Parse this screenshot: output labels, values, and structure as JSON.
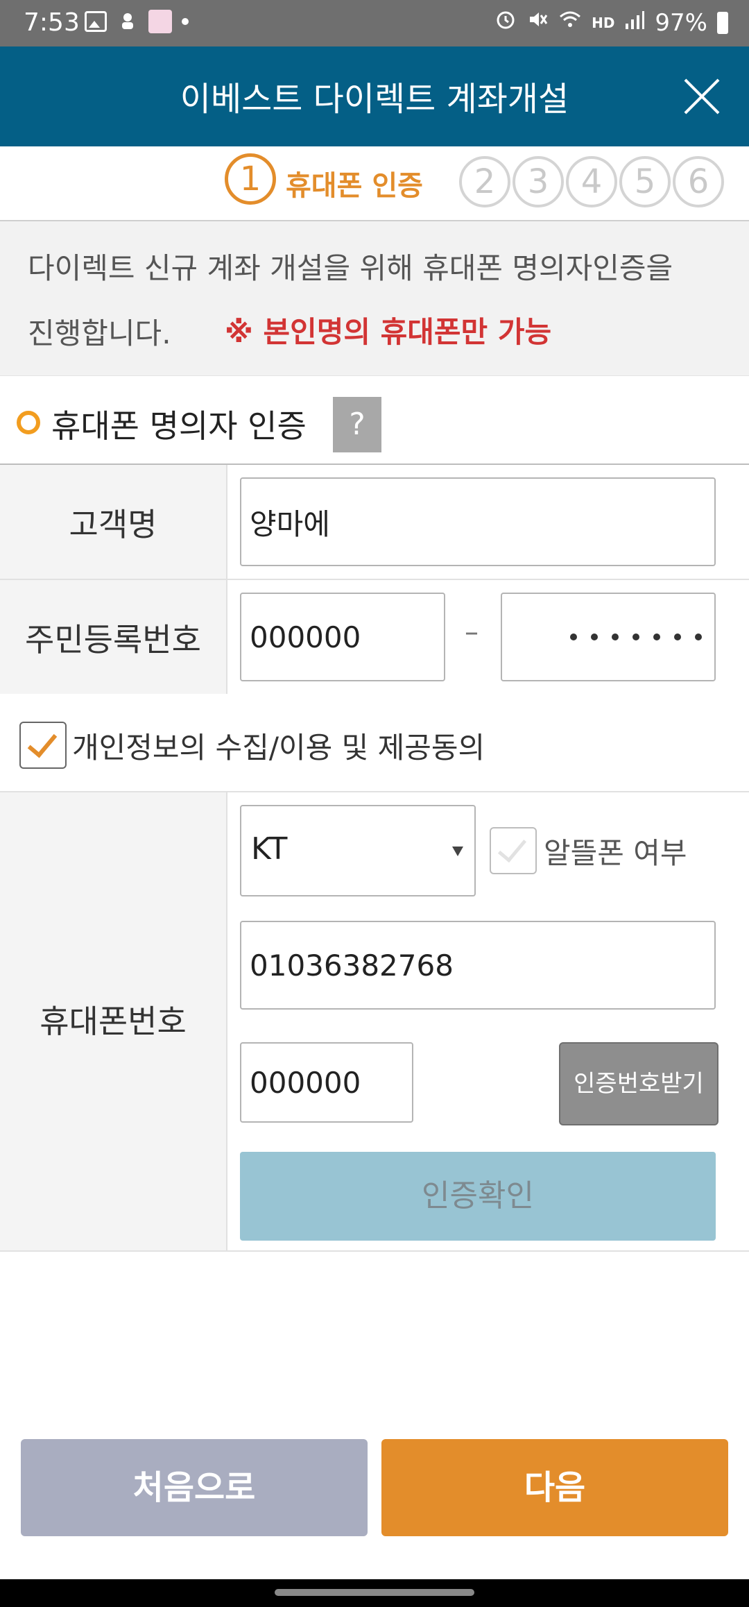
{
  "status_bar": {
    "time": "7:53",
    "hd_label": "HD",
    "battery": "97%"
  },
  "header": {
    "title": "이베스트 다이렉트 계좌개설"
  },
  "steps": {
    "active_number": "1",
    "active_label": "휴대폰 인증",
    "others": [
      "2",
      "3",
      "4",
      "5",
      "6"
    ]
  },
  "info": {
    "line1": "다이렉트 신규 계좌 개설을 위해 휴대폰 명의자인증을",
    "line2": "진행합니다.",
    "warning": "※ 본인명의 휴대폰만 가능"
  },
  "section": {
    "title": "휴대폰 명의자 인증",
    "help": "?"
  },
  "form": {
    "name_label": "고객명",
    "name_value": "양마에",
    "rrn_label": "주민등록번호",
    "rrn_front": "000000",
    "rrn_dash": "–",
    "consent_label": "개인정보의 수집/이용 및 제공동의",
    "phone_label": "휴대폰번호",
    "carrier": "KT",
    "mvno_label": "알뜰폰 여부",
    "phone_value": "01036382768",
    "code_value": "000000",
    "get_code_button": "인증번호받기",
    "confirm_button": "인증확인"
  },
  "footer": {
    "first_button": "처음으로",
    "next_button": "다음"
  },
  "colors": {
    "header_bg": "#045f86",
    "accent_orange": "#e38d2b",
    "warning_red": "#d23434",
    "confirm_disabled": "#98c4d3"
  }
}
